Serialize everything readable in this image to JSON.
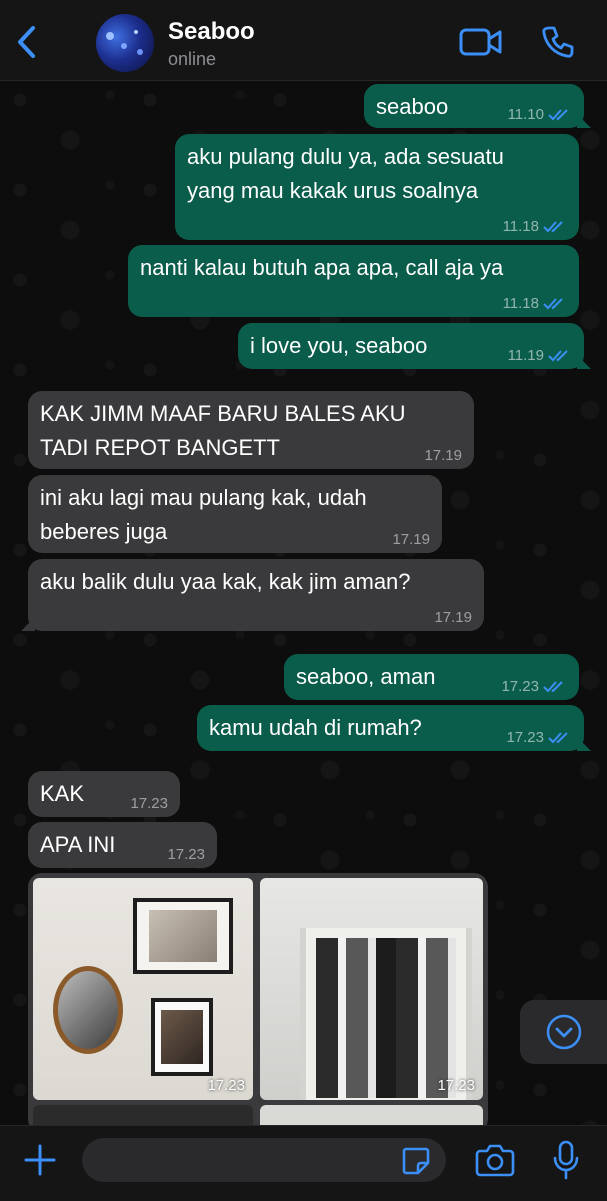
{
  "header": {
    "contact_name": "Seaboo",
    "status": "online",
    "icons": [
      "chevron-left-icon",
      "video-call-icon",
      "phone-icon"
    ]
  },
  "accent_color": "#3b8ff6",
  "messages": [
    {
      "dir": "out",
      "text": "seaboo",
      "time": "11.10",
      "read": true
    },
    {
      "dir": "out",
      "text": "aku pulang dulu ya, ada sesuatu\nyang mau kakak urus soalnya",
      "time": "11.18",
      "read": true
    },
    {
      "dir": "out",
      "text": "nanti kalau butuh apa apa, call aja ya",
      "time": "11.18",
      "read": true
    },
    {
      "dir": "out",
      "text": "i love you, seaboo",
      "time": "11.19",
      "read": true
    },
    {
      "dir": "in",
      "text": "KAK JIMM MAAF BARU BALES AKU\nTADI REPOT BANGETT",
      "time": "17.19"
    },
    {
      "dir": "in",
      "text": "ini aku lagi mau pulang kak, udah\nbeberes juga",
      "time": "17.19"
    },
    {
      "dir": "in",
      "text": "aku balik dulu yaa kak, kak jim aman?",
      "time": "17.19"
    },
    {
      "dir": "out",
      "text": "seaboo, aman",
      "time": "17.23",
      "read": true
    },
    {
      "dir": "out",
      "text": "kamu udah di rumah?",
      "time": "17.23",
      "read": true
    },
    {
      "dir": "in",
      "text": "KAK",
      "time": "17.23"
    },
    {
      "dir": "in",
      "text": "APA INI",
      "time": "17.23"
    }
  ],
  "album": {
    "photos": [
      {
        "time": "17.23",
        "subject": "photo frames on wall"
      },
      {
        "time": "17.23",
        "subject": "drawer with clothes"
      },
      {
        "time": "",
        "subject": "photo partially visible"
      },
      {
        "time": "",
        "subject": "photo partially visible"
      }
    ]
  },
  "composer": {
    "input_value": "",
    "icons": [
      "plus-icon",
      "sticker-icon",
      "camera-icon",
      "microphone-icon"
    ]
  }
}
